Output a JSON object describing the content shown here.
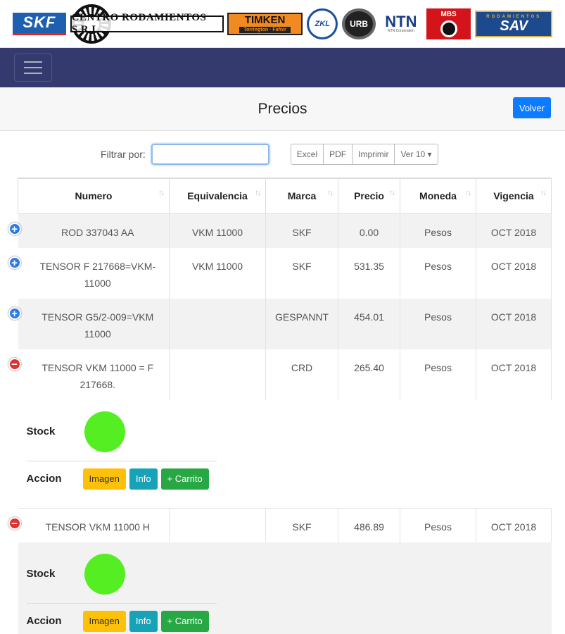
{
  "brands": {
    "skf": "SKF",
    "centro": "CENTRO RODAMIENTOS S.R.L.",
    "timken": "TIMKEN",
    "timken_sub": "Torrington · Fafnir",
    "zkl": "ZKL",
    "urb": "URB",
    "ntn": "NTN",
    "ntn_sub": "NTN Corporation",
    "mbs": "MBS",
    "sav": "SAV",
    "sav_sub": "RODAMIENTOS"
  },
  "header": {
    "title": "Precios",
    "back_label": "Volver"
  },
  "filter": {
    "label": "Filtrar por:",
    "value": ""
  },
  "export": {
    "excel": "Excel",
    "pdf": "PDF",
    "print": "Imprimir",
    "show": "Ver 10 ▾"
  },
  "columns": [
    "Numero",
    "Equivalencia",
    "Marca",
    "Precio",
    "Moneda",
    "Vigencia"
  ],
  "sort_glyph": "↑↓",
  "rows": [
    {
      "numero": "ROD 337043 AA",
      "equivalencia": "VKM 11000",
      "marca": "SKF",
      "precio": "0.00",
      "moneda": "Pesos",
      "vigencia": "OCT 2018",
      "toggle": "+"
    },
    {
      "numero": "TENSOR F 217668=VKM-11000",
      "equivalencia": "VKM 11000",
      "marca": "SKF",
      "precio": "531.35",
      "moneda": "Pesos",
      "vigencia": "OCT 2018",
      "toggle": "+"
    },
    {
      "numero": "TENSOR G5/2-009=VKM 11000",
      "equivalencia": "",
      "marca": "GESPANNT",
      "precio": "454.01",
      "moneda": "Pesos",
      "vigencia": "OCT 2018",
      "toggle": "+"
    },
    {
      "numero": "TENSOR VKM 11000 = F 217668.",
      "equivalencia": "",
      "marca": "CRD",
      "precio": "265.40",
      "moneda": "Pesos",
      "vigencia": "OCT 2018",
      "toggle": "−"
    },
    {
      "numero": "TENSOR VKM 11000 H",
      "equivalencia": "",
      "marca": "SKF",
      "precio": "486.89",
      "moneda": "Pesos",
      "vigencia": "OCT 2018",
      "toggle": "−"
    }
  ],
  "detail": {
    "stock_label": "Stock",
    "accion_label": "Accion",
    "imagen": "Imagen",
    "info": "Info",
    "carrito": "+ Carrito",
    "stock_color": "#55ee22"
  }
}
